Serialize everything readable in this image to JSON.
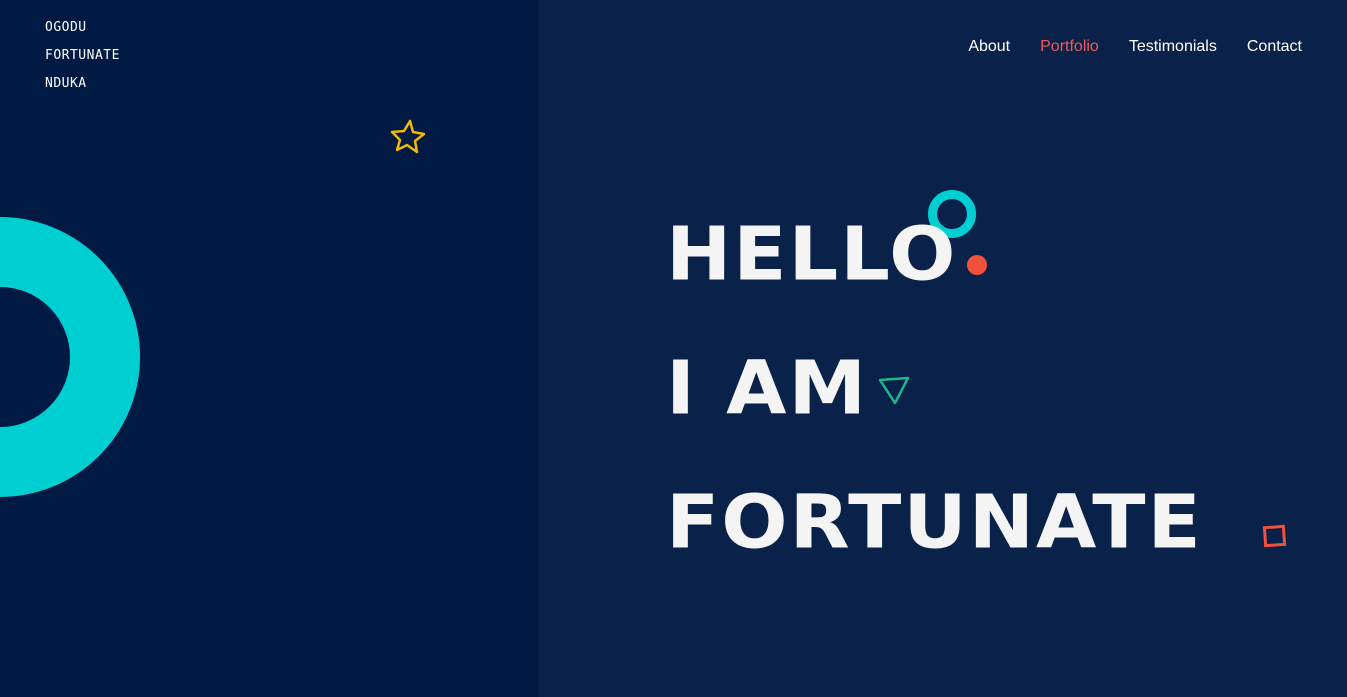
{
  "logo": {
    "line1": "OGODU",
    "line2": "FORTUNATE",
    "line3": "NDUKA"
  },
  "nav": {
    "items": [
      {
        "label": "About",
        "active": false
      },
      {
        "label": "Portfolio",
        "active": true
      },
      {
        "label": "Testimonials",
        "active": false
      },
      {
        "label": "Contact",
        "active": false
      }
    ]
  },
  "hero": {
    "line1": "Hello",
    "line2": "I am",
    "line3": "Fortunate"
  },
  "colors": {
    "left_bg": "#001a44",
    "right_bg": "#0a2249",
    "accent_cyan": "#00cfd1",
    "accent_red": "#f25a5a",
    "accent_yellow": "#f5b800",
    "accent_green": "#1fb58a"
  },
  "decorations": {
    "star": "star-icon",
    "ring": "ring-shape",
    "triangle": "triangle-icon",
    "square": "square-icon",
    "dot": "dot-shape"
  }
}
